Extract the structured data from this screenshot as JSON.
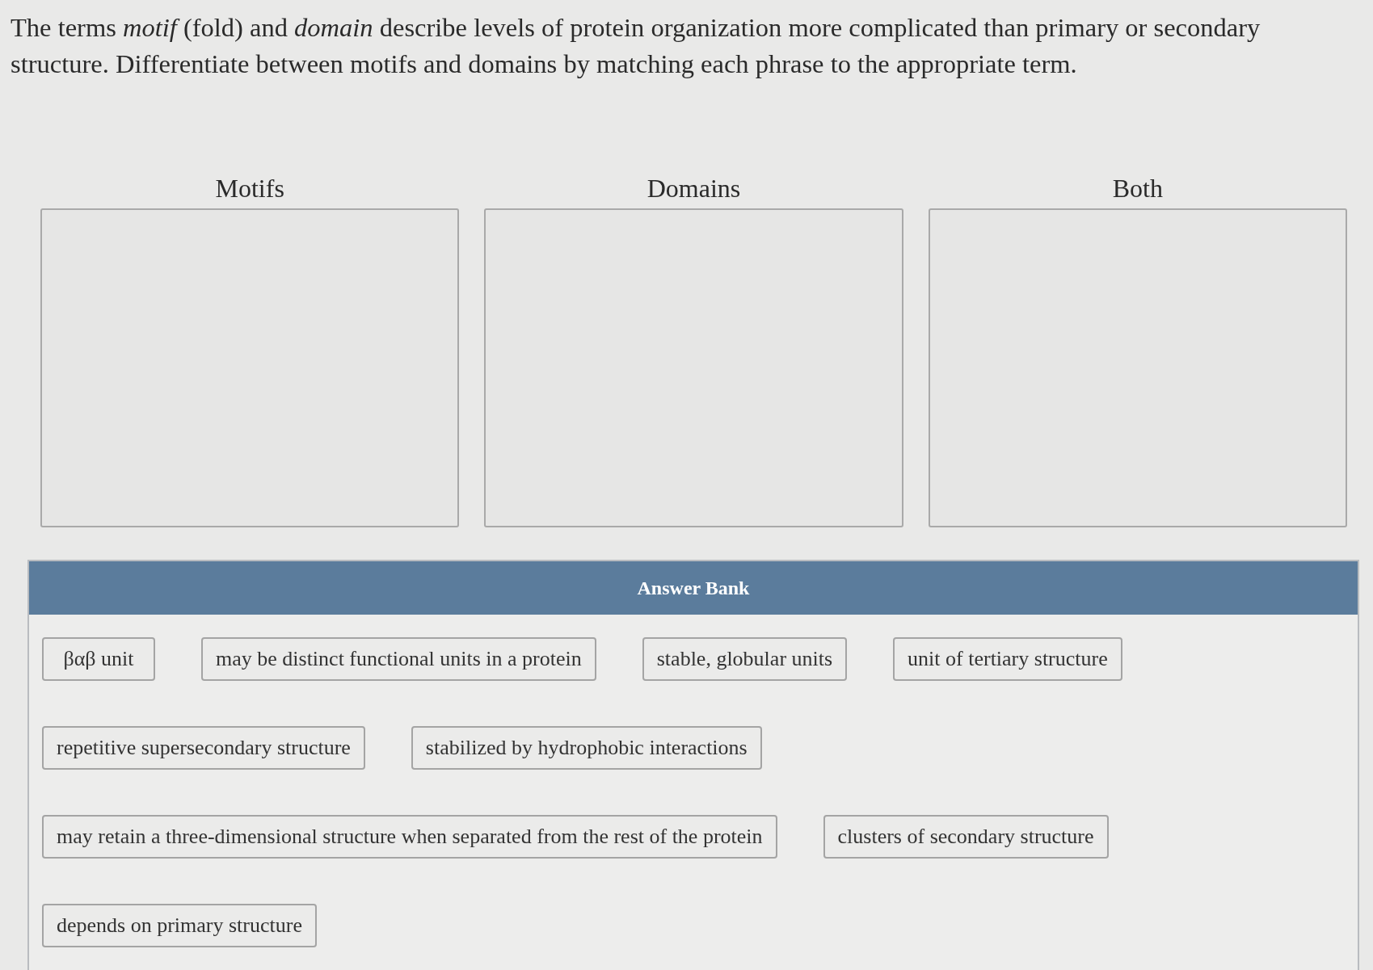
{
  "prompt": "The terms *motif* (fold) and *domain* describe levels of protein organization more complicated than primary or secondary structure. Differentiate between motifs and domains by matching each phrase to the appropriate term.",
  "categories": [
    {
      "label": "Motifs"
    },
    {
      "label": "Domains"
    },
    {
      "label": "Both"
    }
  ],
  "answer_bank": {
    "title": "Answer Bank",
    "items": [
      "βαβ unit",
      "may be distinct functional units in a protein",
      "stable, globular units",
      "unit of tertiary structure",
      "repetitive supersecondary structure",
      "stabilized by hydrophobic interactions",
      "may retain a three-dimensional structure when separated from the rest of the protein",
      "clusters of secondary structure",
      "depends on primary structure"
    ]
  }
}
